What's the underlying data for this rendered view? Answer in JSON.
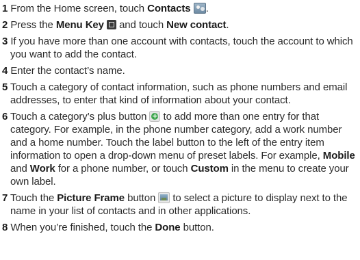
{
  "steps": [
    {
      "num": "1",
      "t1": "From the Home screen, touch ",
      "b1": "Contacts",
      "icon": "contacts-app-icon",
      "t2": "."
    },
    {
      "num": "2",
      "t1": "Press the ",
      "b1": "Menu Key",
      "icon": "menu-key-icon",
      "t2": " and touch ",
      "b2": "New contact",
      "t3": "."
    },
    {
      "num": "3",
      "text": "If you have more than one account with contacts, touch the account to which you want to add the contact."
    },
    {
      "num": "4",
      "text": "Enter the contact’s name."
    },
    {
      "num": "5",
      "text": "Touch a category of contact information, such as phone numbers and email addresses, to enter that kind of information about your contact."
    },
    {
      "num": "6",
      "t1": "Touch a category’s plus button ",
      "icon": "plus-button-icon",
      "t2": " to add more than one entry for that category. For example, in the phone number category, add a work number and a home number. Touch the label button to the left of the entry item information to open a drop-down menu of preset labels. For example, ",
      "b1": "Mobile",
      "t3": " and ",
      "b2": "Work",
      "t4": " for a phone number, or touch ",
      "b3": "Custom",
      "t5": " in the menu to create your own label."
    },
    {
      "num": "7",
      "t1": "Touch the ",
      "b1": "Picture Frame",
      "t2": " button ",
      "icon": "picture-frame-icon",
      "t3": " to select a picture to display next to the name in your list of contacts and in other applications."
    },
    {
      "num": "8",
      "t1": "When you’re finished, touch the ",
      "b1": "Done",
      "t2": " button."
    }
  ]
}
